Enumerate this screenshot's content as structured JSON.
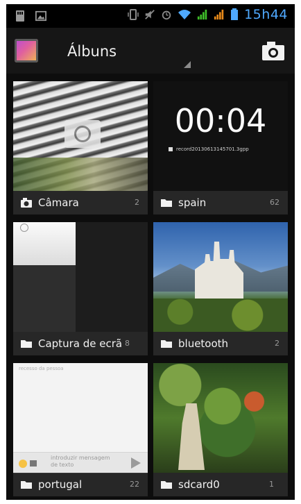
{
  "status_bar": {
    "time": "15h44",
    "icons": [
      "sd-card-icon",
      "image-icon",
      "vibrate-icon",
      "mute-icon",
      "alarm-icon",
      "wifi-icon",
      "signal-icon",
      "signal-icon",
      "battery-icon"
    ]
  },
  "action_bar": {
    "title": "Álbuns",
    "app_icon": "gallery-app-icon",
    "camera_icon": "camera-icon"
  },
  "albums": [
    {
      "name": "Câmara",
      "count": "2",
      "icon": "camera-icon"
    },
    {
      "name": "spain",
      "count": "62",
      "icon": "folder-icon",
      "thumb_time": "00:04",
      "thumb_file": "record20130613145701.3gpp"
    },
    {
      "name": "Captura de ecrã",
      "count": "8",
      "icon": "folder-icon"
    },
    {
      "name": "bluetooth",
      "count": "2",
      "icon": "folder-icon"
    },
    {
      "name": "portugal",
      "count": "22",
      "icon": "folder-icon",
      "thumb_top": "recesso da pessoa",
      "thumb_input": "introduzir mensagem de texto"
    },
    {
      "name": "sdcard0",
      "count": "1",
      "icon": "folder-icon"
    }
  ],
  "colors": {
    "status_accent": "#4fa9ff",
    "background": "#000000",
    "label_bar": "#282828"
  }
}
